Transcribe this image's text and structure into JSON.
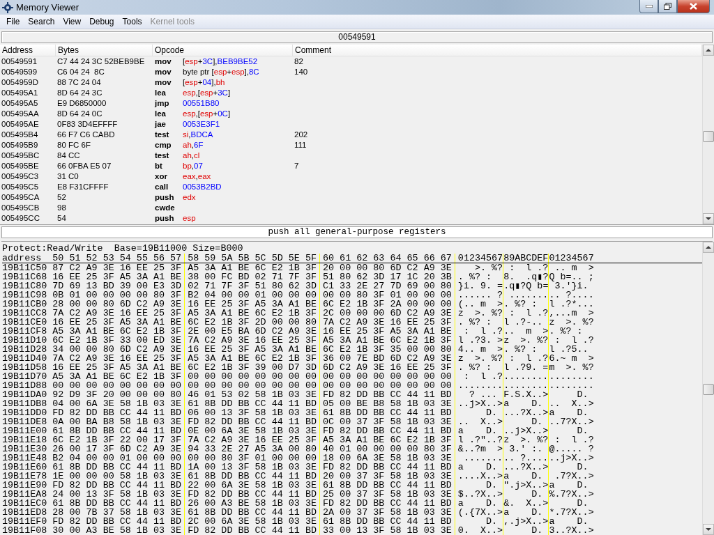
{
  "window": {
    "title": "Memory Viewer"
  },
  "menu": [
    {
      "label": "File",
      "disabled": false
    },
    {
      "label": "Search",
      "disabled": false
    },
    {
      "label": "View",
      "disabled": false
    },
    {
      "label": "Debug",
      "disabled": false
    },
    {
      "label": "Tools",
      "disabled": false
    },
    {
      "label": "Kernel tools",
      "disabled": true
    }
  ],
  "address_bar": {
    "value": "00549591"
  },
  "disassembly": {
    "columns": [
      "Address",
      "Bytes",
      "Opcode",
      "Comment"
    ],
    "rows": [
      {
        "address": "00549591",
        "bytes": "C7 44 24 3C 52BEB9BE",
        "mnemonic": "mov",
        "operands": [
          {
            "kind": "plain",
            "text": "["
          },
          {
            "kind": "reg",
            "text": "esp"
          },
          {
            "kind": "plain",
            "text": "+"
          },
          {
            "kind": "num",
            "text": "3C"
          },
          {
            "kind": "plain",
            "text": "],"
          },
          {
            "kind": "num",
            "text": "BEB9BE52"
          }
        ],
        "comment": "82"
      },
      {
        "address": "00549599",
        "bytes": "C6 04 24  8C",
        "mnemonic": "mov",
        "operands": [
          {
            "kind": "plain",
            "text": "byte ptr ["
          },
          {
            "kind": "reg",
            "text": "esp"
          },
          {
            "kind": "plain",
            "text": "+"
          },
          {
            "kind": "reg",
            "text": "esp"
          },
          {
            "kind": "plain",
            "text": "],"
          },
          {
            "kind": "num",
            "text": "8C"
          }
        ],
        "comment": "140"
      },
      {
        "address": "0054959D",
        "bytes": "88 7C 24 04",
        "mnemonic": "mov",
        "operands": [
          {
            "kind": "plain",
            "text": "["
          },
          {
            "kind": "reg",
            "text": "esp"
          },
          {
            "kind": "plain",
            "text": "+"
          },
          {
            "kind": "num",
            "text": "04"
          },
          {
            "kind": "plain",
            "text": "],"
          },
          {
            "kind": "reg",
            "text": "bh"
          }
        ]
      },
      {
        "address": "005495A1",
        "bytes": "8D 64 24 3C",
        "mnemonic": "lea",
        "operands": [
          {
            "kind": "reg",
            "text": "esp"
          },
          {
            "kind": "plain",
            "text": ",["
          },
          {
            "kind": "reg",
            "text": "esp"
          },
          {
            "kind": "plain",
            "text": "+"
          },
          {
            "kind": "num",
            "text": "3C"
          },
          {
            "kind": "plain",
            "text": "]"
          }
        ]
      },
      {
        "address": "005495A5",
        "bytes": "E9 D6850000",
        "mnemonic": "jmp",
        "operands": [
          {
            "kind": "num",
            "text": "00551B80"
          }
        ]
      },
      {
        "address": "005495AA",
        "bytes": "8D 64 24 0C",
        "mnemonic": "lea",
        "operands": [
          {
            "kind": "reg",
            "text": "esp"
          },
          {
            "kind": "plain",
            "text": ",["
          },
          {
            "kind": "reg",
            "text": "esp"
          },
          {
            "kind": "plain",
            "text": "+"
          },
          {
            "kind": "num",
            "text": "0C"
          },
          {
            "kind": "plain",
            "text": "]"
          }
        ]
      },
      {
        "address": "005495AE",
        "bytes": "0F83 3D4EFFFF",
        "mnemonic": "jae",
        "operands": [
          {
            "kind": "num",
            "text": "0053E3F1"
          }
        ]
      },
      {
        "address": "005495B4",
        "bytes": "66 F7 C6 CABD",
        "mnemonic": "test",
        "operands": [
          {
            "kind": "reg",
            "text": "si"
          },
          {
            "kind": "plain",
            "text": ","
          },
          {
            "kind": "num",
            "text": "BDCA"
          }
        ],
        "comment": "202"
      },
      {
        "address": "005495B9",
        "bytes": "80 FC 6F",
        "mnemonic": "cmp",
        "operands": [
          {
            "kind": "reg",
            "text": "ah"
          },
          {
            "kind": "plain",
            "text": ","
          },
          {
            "kind": "num",
            "text": "6F"
          }
        ],
        "comment": "111"
      },
      {
        "address": "005495BC",
        "bytes": "84 CC",
        "mnemonic": "test",
        "operands": [
          {
            "kind": "reg",
            "text": "ah"
          },
          {
            "kind": "plain",
            "text": ","
          },
          {
            "kind": "reg",
            "text": "cl"
          }
        ]
      },
      {
        "address": "005495BE",
        "bytes": "66 0FBA E5 07",
        "mnemonic": "bt",
        "operands": [
          {
            "kind": "reg",
            "text": "bp"
          },
          {
            "kind": "plain",
            "text": ","
          },
          {
            "kind": "num",
            "text": "07"
          }
        ],
        "comment": "7"
      },
      {
        "address": "005495C3",
        "bytes": "31 C0",
        "mnemonic": "xor",
        "operands": [
          {
            "kind": "reg",
            "text": "eax"
          },
          {
            "kind": "plain",
            "text": ","
          },
          {
            "kind": "reg",
            "text": "eax"
          }
        ]
      },
      {
        "address": "005495C5",
        "bytes": "E8 F31CFFFF",
        "mnemonic": "call",
        "operands": [
          {
            "kind": "num",
            "text": "0053B2BD"
          }
        ]
      },
      {
        "address": "005495CA",
        "bytes": "52",
        "mnemonic": "push",
        "operands": [
          {
            "kind": "reg",
            "text": "edx"
          }
        ]
      },
      {
        "address": "005495CB",
        "bytes": "98",
        "mnemonic": "cwde"
      },
      {
        "address": "005495CC",
        "bytes": "54",
        "mnemonic": "push",
        "operands": [
          {
            "kind": "reg",
            "text": "esp"
          }
        ]
      }
    ]
  },
  "instruction_description": "push all general-purpose registers",
  "hex_view": {
    "protect_info": "Protect:Read/Write  Base=19B11000 Size=B000",
    "header": {
      "address": "address",
      "groups": [
        "50 51 52 53 54 55 56 57",
        "58 59 5A 5B 5C 5D 5E 5F",
        "60 61 62 63 64 65 66 67"
      ],
      "ascii": [
        "01234567",
        "89ABCDEF",
        "01234567"
      ]
    },
    "rows": [
      {
        "address": "19B11C50",
        "groups": [
          "87 C2 A9 3E 16 EE 25 3F",
          "A5 3A A1 BE 6C E2 1B 3F",
          "20 00 00 80 6D C2 A9 3E"
        ],
        "ascii": [
          "   >. %?",
          " :  l .?",
          " .. m  >"
        ]
      },
      {
        "address": "19B11C68",
        "groups": [
          "16 EE 25 3F A5 3A A1 BE",
          "38 00 FC BD 02 71 7F 3F",
          "51 80 62 3D 17 1C 20 3B"
        ],
        "ascii": [
          ". %? :  ",
          "8.  .q▮?",
          "Q b=.. ;"
        ]
      },
      {
        "address": "19B11C80",
        "groups": [
          "7D 69 13 BD 39 00 E3 3D",
          "02 71 7F 3F 51 80 62 3D",
          "C1 33 2E 27 7D 69 00 80"
        ],
        "ascii": [
          "}i. 9. =",
          ".q▮?Q b=",
          " 3.'}i. "
        ]
      },
      {
        "address": "19B11C98",
        "groups": [
          "0B 01 00 00 00 00 80 3F",
          "B2 04 00 00 01 00 00 00",
          "00 00 80 3F 01 00 00 00"
        ],
        "ascii": [
          "...... ?",
          " .......",
          ".. ?...."
        ]
      },
      {
        "address": "19B11CB0",
        "groups": [
          "28 00 00 80 6D C2 A9 3E",
          "16 EE 25 3F A5 3A A1 BE",
          "6C E2 1B 3F 2A 00 00 00"
        ],
        "ascii": [
          "(.. m  >",
          ". %? :  ",
          "l .?*..."
        ]
      },
      {
        "address": "19B11CC8",
        "groups": [
          "7A C2 A9 3E 16 EE 25 3F",
          "A5 3A A1 BE 6C E2 1B 3F",
          "2C 00 00 00 6D C2 A9 3E"
        ],
        "ascii": [
          "z  >. %?",
          " :  l .?",
          ",...m  >"
        ]
      },
      {
        "address": "19B11CE0",
        "groups": [
          "16 EE 25 3F A5 3A A1 BE",
          "6C E2 1B 3F 2D 00 00 80",
          "7A C2 A9 3E 16 EE 25 3F"
        ],
        "ascii": [
          ". %? :  ",
          "l .?-.. ",
          "z  >. %?"
        ]
      },
      {
        "address": "19B11CF8",
        "groups": [
          "A5 3A A1 BE 6C E2 1B 3F",
          "2E 00 E5 BA 6D C2 A9 3E",
          "16 EE 25 3F A5 3A A1 BE"
        ],
        "ascii": [
          " :  l .?",
          "..  m  >",
          ". %? :  "
        ]
      },
      {
        "address": "19B11D10",
        "groups": [
          "6C E2 1B 3F 33 00 ED 3E",
          "7A C2 A9 3E 16 EE 25 3F",
          "A5 3A A1 BE 6C E2 1B 3F"
        ],
        "ascii": [
          "l .?3. >",
          "z  >. %?",
          " :  l .?"
        ]
      },
      {
        "address": "19B11D28",
        "groups": [
          "34 00 00 80 6D C2 A9 3E",
          "16 EE 25 3F A5 3A A1 BE",
          "6C E2 1B 3F 35 00 00 80"
        ],
        "ascii": [
          "4.. m  >",
          ". %? :  ",
          "l .?5.. "
        ]
      },
      {
        "address": "19B11D40",
        "groups": [
          "7A C2 A9 3E 16 EE 25 3F",
          "A5 3A A1 BE 6C E2 1B 3F",
          "36 00 7E BD 6D C2 A9 3E"
        ],
        "ascii": [
          "z  >. %?",
          " :  l .?",
          "6.~ m  >"
        ]
      },
      {
        "address": "19B11D58",
        "groups": [
          "16 EE 25 3F A5 3A A1 BE",
          "6C E2 1B 3F 39 00 D7 3D",
          "6D C2 A9 3E 16 EE 25 3F"
        ],
        "ascii": [
          ". %? :  ",
          "l .?9. =",
          "m  >. %?"
        ]
      },
      {
        "address": "19B11D70",
        "groups": [
          "A5 3A A1 BE 6C E2 1B 3F",
          "00 00 00 00 00 00 00 00",
          "00 00 00 00 00 00 00 00"
        ],
        "ascii": [
          " :  l .?",
          "........",
          "........"
        ]
      },
      {
        "address": "19B11D88",
        "groups": [
          "00 00 00 00 00 00 00 00",
          "00 00 00 00 00 00 00 00",
          "00 00 00 00 00 00 00 00"
        ],
        "ascii": [
          "........",
          "........",
          "........"
        ]
      },
      {
        "address": "19B11DA0",
        "groups": [
          "92 D9 3F 20 00 00 00 80",
          "46 01 53 02 58 1B 03 3E",
          "FD 82 DD BB CC 44 11 BD"
        ],
        "ascii": [
          "  ? ... ",
          "F.S.X..>",
          "     D. "
        ]
      },
      {
        "address": "19B11DB8",
        "groups": [
          "04 00 6A 3E 58 1B 03 3E",
          "61 8B DD BB CC 44 11 BD",
          "05 00 BE B8 58 1B 03 3E"
        ],
        "ascii": [
          "..j>X..>",
          "a    D. ",
          "..  X..>"
        ]
      },
      {
        "address": "19B11DD0",
        "groups": [
          "FD 82 DD BB CC 44 11 BD",
          "06 00 13 3F 58 1B 03 3E",
          "61 8B DD BB CC 44 11 BD"
        ],
        "ascii": [
          "     D. ",
          "...?X..>",
          "a    D. "
        ]
      },
      {
        "address": "19B11DE8",
        "groups": [
          "0A 00 BA B8 58 1B 03 3E",
          "FD 82 DD BB CC 44 11 BD",
          "0C 00 37 3F 58 1B 03 3E"
        ],
        "ascii": [
          "..  X..>",
          "     D. ",
          "..7?X..>"
        ]
      },
      {
        "address": "19B11E00",
        "groups": [
          "61 8B DD BB CC 44 11 BD",
          "0E 00 6A 3E 58 1B 03 3E",
          "FD 82 DD BB CC 44 11 BD"
        ],
        "ascii": [
          "a    D. ",
          "..j>X..>",
          "     D. "
        ]
      },
      {
        "address": "19B11E18",
        "groups": [
          "6C E2 1B 3F 22 00 17 3F",
          "7A C2 A9 3E 16 EE 25 3F",
          "A5 3A A1 BE 6C E2 1B 3F"
        ],
        "ascii": [
          "l .?\"..?",
          "z  >. %?",
          " :  l .?"
        ]
      },
      {
        "address": "19B11E30",
        "groups": [
          "26 00 17 3F 6D C2 A9 3E",
          "94 33 2E 27 A5 3A 00 80",
          "40 01 00 00 00 00 80 3F"
        ],
        "ascii": [
          "&..?m  >",
          " 3.' :. ",
          "@..... ?"
        ]
      },
      {
        "address": "19B11E48",
        "groups": [
          "B2 04 00 00 01 00 00 00",
          "00 00 80 3F 01 00 00 00",
          "18 00 6A 3E 58 1B 03 3E"
        ],
        "ascii": [
          " .......",
          ".. ?....",
          "..j>X..>"
        ]
      },
      {
        "address": "19B11E60",
        "groups": [
          "61 8B DD BB CC 44 11 BD",
          "1A 00 13 3F 58 1B 03 3E",
          "FD 82 DD BB CC 44 11 BD"
        ],
        "ascii": [
          "a    D. ",
          "...?X..>",
          "     D. "
        ]
      },
      {
        "address": "19B11E78",
        "groups": [
          "1E 00 00 00 58 1B 03 3E",
          "61 8B DD BB CC 44 11 BD",
          "20 00 37 3F 58 1B 03 3E"
        ],
        "ascii": [
          "....X..>",
          "a    D. ",
          " .7?X..>"
        ]
      },
      {
        "address": "19B11E90",
        "groups": [
          "FD 82 DD BB CC 44 11 BD",
          "22 00 6A 3E 58 1B 03 3E",
          "61 8B DD BB CC 44 11 BD"
        ],
        "ascii": [
          "     D. ",
          "\".j>X..>",
          "a    D. "
        ]
      },
      {
        "address": "19B11EA8",
        "groups": [
          "24 00 13 3F 58 1B 03 3E",
          "FD 82 DD BB CC 44 11 BD",
          "25 00 37 3F 58 1B 03 3E"
        ],
        "ascii": [
          "$..?X..>",
          "     D. ",
          "%.7?X..>"
        ]
      },
      {
        "address": "19B11EC0",
        "groups": [
          "61 8B DD BB CC 44 11 BD",
          "26 00 A3 BE 58 1B 03 3E",
          "FD 82 DD BB CC 44 11 BD"
        ],
        "ascii": [
          "a    D. ",
          "&.  X..>",
          "     D. "
        ]
      },
      {
        "address": "19B11ED8",
        "groups": [
          "28 00 7B 37 58 1B 03 3E",
          "61 8B DD BB CC 44 11 BD",
          "2A 00 37 3F 58 1B 03 3E"
        ],
        "ascii": [
          "(.{7X..>",
          "a    D. ",
          "*.7?X..>"
        ]
      },
      {
        "address": "19B11EF0",
        "groups": [
          "FD 82 DD BB CC 44 11 BD",
          "2C 00 6A 3E 58 1B 03 3E",
          "61 8B DD BB CC 44 11 BD"
        ],
        "ascii": [
          "     D. ",
          ",.j>X..>",
          "a    D. "
        ]
      },
      {
        "address": "19B11F08",
        "groups": [
          "30 00 A3 BE 58 1B 03 3E",
          "FD 82 DD BB CC 44 11 BD",
          "33 00 13 3F 58 1B 03 3E"
        ],
        "ascii": [
          "0.  X..>",
          "     D. ",
          "3..?X..>"
        ]
      }
    ]
  }
}
